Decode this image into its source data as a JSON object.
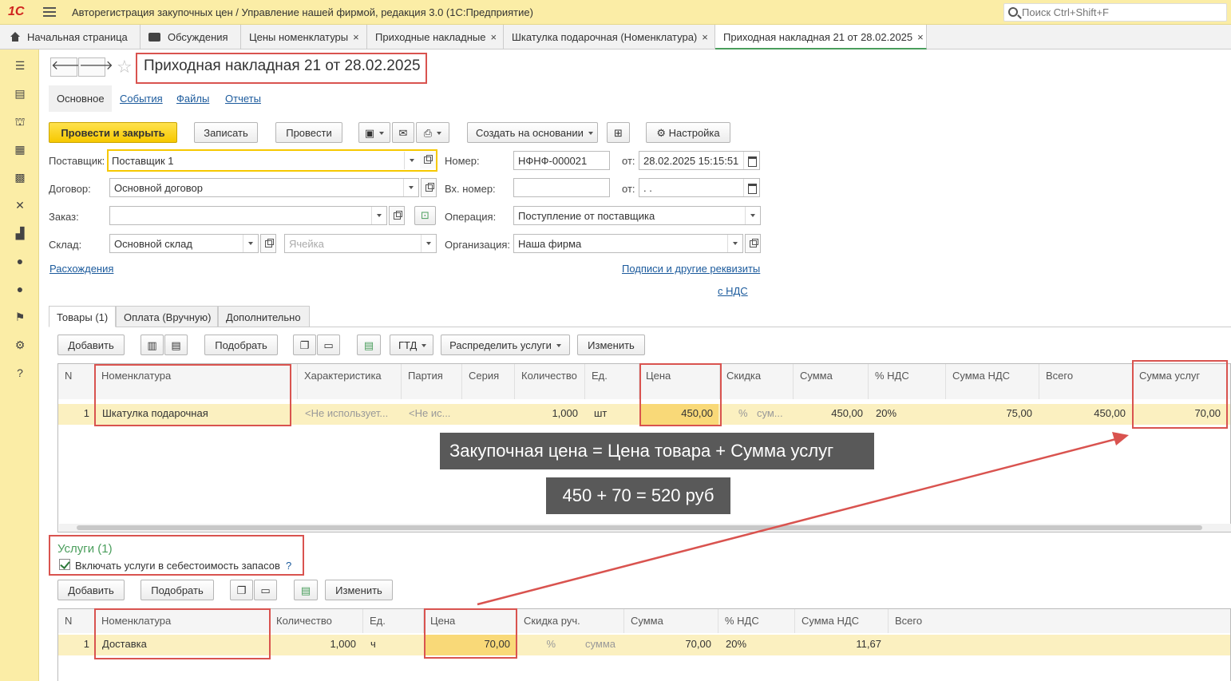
{
  "app": {
    "title": "Авторегистрация закупочных цен / Управление нашей фирмой, редакция 3.0  (1С:Предприятие)",
    "logo": "1С",
    "search_placeholder": "Поиск Ctrl+Shift+F"
  },
  "tabs": [
    {
      "label": "Начальная страница"
    },
    {
      "label": "Обсуждения"
    },
    {
      "label": "Цены номенклатуры",
      "close": "×"
    },
    {
      "label": "Приходные накладные",
      "close": "×"
    },
    {
      "label": "Шкатулка подарочная (Номенклатура)",
      "close": "×"
    },
    {
      "label": "Приходная накладная 21 от 28.02.2025",
      "close": "×"
    }
  ],
  "doc": {
    "title": "Приходная накладная 21 от 28.02.2025",
    "nav_back": "🡐",
    "nav_forward": "🡒",
    "star": "☆"
  },
  "links": {
    "main": "Основное",
    "events": "События",
    "files": "Файлы",
    "reports": "Отчеты"
  },
  "toolbar": {
    "post_close": "Провести и закрыть",
    "save": "Записать",
    "post": "Провести",
    "create_based": "Создать на основании",
    "settings": "Настройка"
  },
  "form": {
    "supplier_label": "Поставщик:",
    "supplier_value": "Поставщик 1",
    "contract_label": "Договор:",
    "contract_value": "Основной договор",
    "order_label": "Заказ:",
    "order_value": "",
    "warehouse_label": "Склад:",
    "warehouse_value": "Основной склад",
    "cell_placeholder": "Ячейка",
    "number_label": "Номер:",
    "number_value": "НФНФ-000021",
    "date_from_label": "от:",
    "date_value": "28.02.2025 15:15:51",
    "in_number_label": "Вх. номер:",
    "in_number_value": "",
    "in_date_label": "от:",
    "in_date_value": " .  .",
    "operation_label": "Операция:",
    "operation_value": "Поступление от поставщика",
    "org_label": "Организация:",
    "org_value": "Наша фирма",
    "discrepancies_link": "Расхождения",
    "signatures_link": "Подписи и другие реквизиты",
    "vat_link": "с НДС"
  },
  "inner_tabs": [
    {
      "label": "Товары (1)"
    },
    {
      "label": "Оплата (Вручную)"
    },
    {
      "label": "Дополнительно"
    }
  ],
  "goods_toolbar": {
    "add": "Добавить",
    "pick": "Подобрать",
    "gtd": "ГТД",
    "distribute": "Распределить услуги",
    "change": "Изменить"
  },
  "goods_table": {
    "headers": [
      "N",
      "Номенклатура",
      "Характеристика",
      "Партия",
      "Серия",
      "Количество",
      "Ед.",
      "Цена",
      "Скидка",
      "Сумма",
      "% НДС",
      "Сумма НДС",
      "Всего",
      "Сумма услуг"
    ],
    "rows": [
      [
        "1",
        "Шкатулка подарочная",
        "<Не использует...",
        "<Не ис...",
        "",
        "1,000",
        "шт",
        "450,00",
        "%",
        "сум...",
        "450,00",
        "20%",
        "75,00",
        "450,00",
        "70,00"
      ]
    ]
  },
  "annotations": {
    "formula": "Закупочная цена = Цена товара + Сумма услуг",
    "calc": "450 + 70 = 520 руб"
  },
  "services": {
    "title": "Услуги (1)",
    "include_label": "Включать услуги в себестоимость запасов",
    "help": "?",
    "toolbar": {
      "add": "Добавить",
      "pick": "Подобрать",
      "change": "Изменить"
    },
    "headers": [
      "N",
      "Номенклатура",
      "Количество",
      "Ед.",
      "Цена",
      "Скидка руч.",
      "Сумма",
      "% НДС",
      "Сумма НДС",
      "Всего"
    ],
    "rows": [
      [
        "1",
        "Доставка",
        "1,000",
        "ч",
        "70,00",
        "%",
        "сумма",
        "70,00",
        "20%",
        "11,67",
        ""
      ]
    ]
  },
  "sidebar_icons": [
    "menu-icon",
    "contacts-icon",
    "basket-icon",
    "cart-icon",
    "grid-icon",
    "tools-icon",
    "factory-icon",
    "ruble-icon",
    "users-icon",
    "flag-icon",
    "gear-icon",
    "help-icon"
  ],
  "colors": {
    "accent_yellow": "#fbeda6",
    "primary_button": "#f6c800",
    "link_blue": "#1b5a9c",
    "highlight_red": "#d9534f",
    "selected_row": "#fbf0c0",
    "green_title": "#4a9e5c"
  }
}
